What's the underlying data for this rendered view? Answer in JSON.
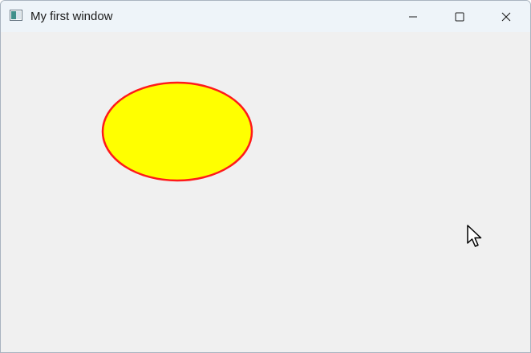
{
  "window": {
    "title": "My first window"
  },
  "caption_buttons": {
    "minimize": "minimize-icon",
    "maximize": "maximize-icon",
    "close": "close-icon"
  },
  "drawing": {
    "shape": "ellipse",
    "fill_color": "#ffff00",
    "stroke_color": "#ff1a1a"
  },
  "icons": {
    "app": "app-window-icon",
    "cursor": "mouse-pointer-icon"
  }
}
